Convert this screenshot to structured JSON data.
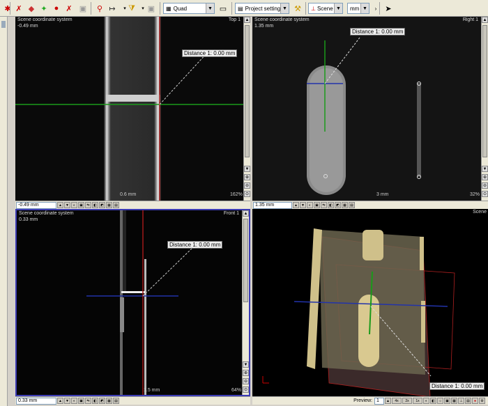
{
  "toolbar": {
    "layout_combo": "Quad",
    "project_settings": "Project settings",
    "scene_combo": "Scene",
    "unit_combo": "mm"
  },
  "views": {
    "top": {
      "coord": "Scene coordinate system",
      "value": "-0.49 mm",
      "name": "Top 1",
      "distance": "Distance 1: 0.00 mm",
      "scale": "0.6 mm",
      "zoom": "162%",
      "combo": "-0.49 mm"
    },
    "right": {
      "coord": "Scene coordinate system",
      "value": "1.35 mm",
      "name": "Right 1",
      "distance": "Distance 1: 0.00 mm",
      "scale": "3 mm",
      "zoom": "32%",
      "combo": "1.35 mm"
    },
    "front": {
      "coord": "Scene coordinate system",
      "value": "0.33 mm",
      "name": "Front 1",
      "distance": "Distance 1: 0.00 mm",
      "scale": "1.5 mm",
      "zoom": "64%",
      "combo": "0.33 mm"
    },
    "scene": {
      "name": "Scene",
      "distance": "Distance 1: 0.00 mm",
      "preview_label": "Preview:",
      "preview_value": "1",
      "buttons": [
        "4x",
        "2x",
        "1x"
      ]
    }
  }
}
